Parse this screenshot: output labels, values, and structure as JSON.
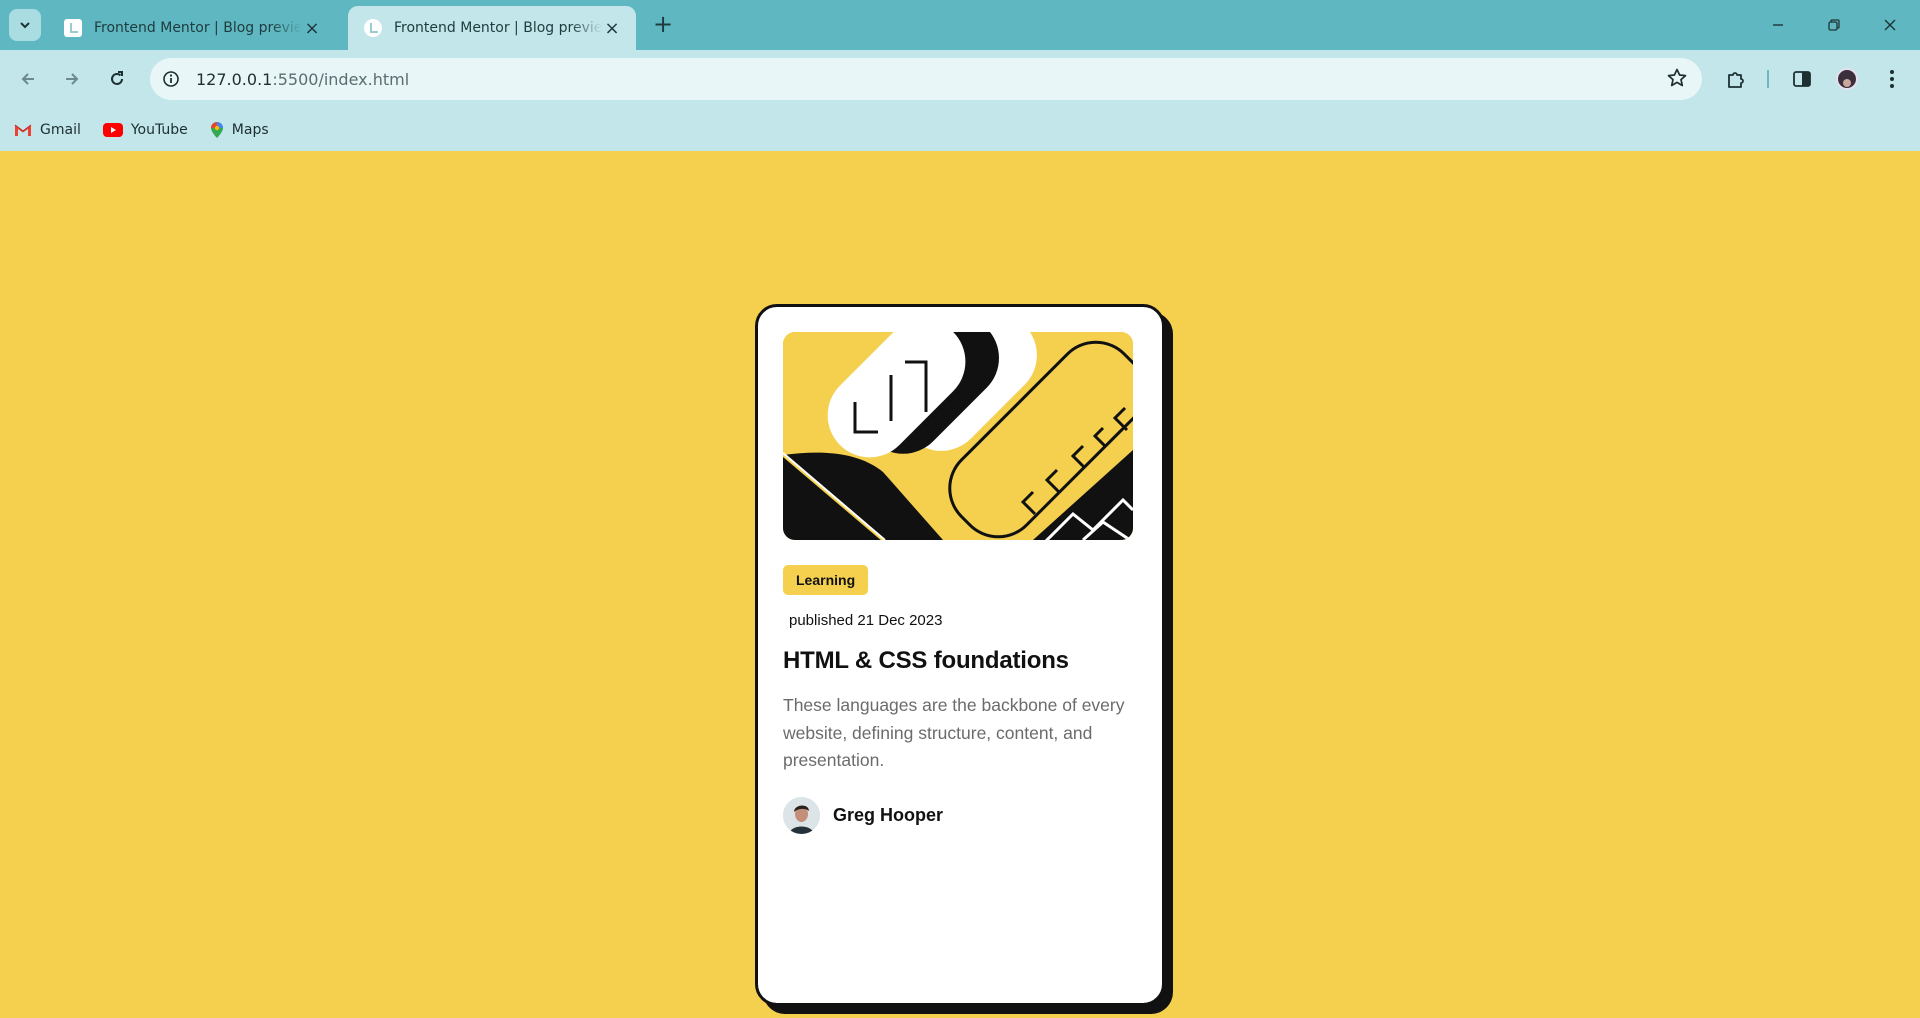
{
  "browser": {
    "tabs": [
      {
        "title": "Frontend Mentor | Blog preview card",
        "active": false
      },
      {
        "title": "Frontend Mentor | Blog preview card",
        "active": true
      }
    ],
    "address": {
      "host": "127.0.0.1",
      "rest": ":5500/index.html"
    },
    "bookmarks": [
      {
        "label": "Gmail",
        "icon": "gmail-icon"
      },
      {
        "label": "YouTube",
        "icon": "youtube-icon"
      },
      {
        "label": "Maps",
        "icon": "maps-icon"
      }
    ]
  },
  "card": {
    "tag": "Learning",
    "published": "published 21 Dec 2023",
    "title": "HTML & CSS foundations",
    "description": "These languages are the backbone of every website, defining structure, content, and presentation.",
    "author": "Greg Hooper"
  },
  "colors": {
    "page_background": "#f4d04e",
    "chrome_tabstrip": "#5fb8c1",
    "chrome_toolbar": "#c2e6ea",
    "card_border": "#111111",
    "description_text": "#6b6b6b"
  }
}
